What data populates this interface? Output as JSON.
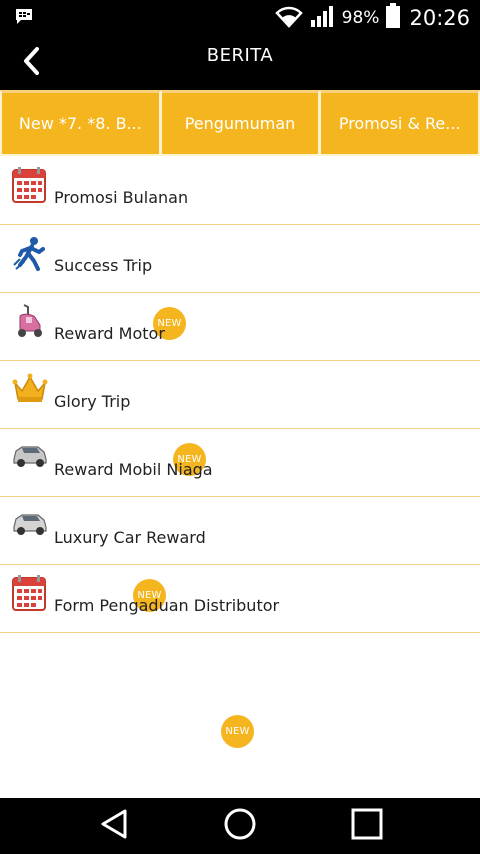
{
  "status_bar": {
    "battery_percent": "98%",
    "time": "20:26",
    "icons": [
      "bbm-icon",
      "wifi-icon",
      "signal-icon",
      "battery-icon"
    ]
  },
  "app_bar": {
    "title": "BERITA",
    "back_icon": "chevron-left-icon"
  },
  "tabs": [
    {
      "label": "New *7. *8. B..."
    },
    {
      "label": "Pengumuman"
    },
    {
      "label": "Promosi & Re..."
    }
  ],
  "items": [
    {
      "label": "Promosi Bulanan",
      "icon": "calendar-icon",
      "badge": ""
    },
    {
      "label": "Success Trip",
      "icon": "running-man-icon",
      "badge": "NEW"
    },
    {
      "label": "Reward Motor",
      "icon": "scooter-icon",
      "badge": "NEW"
    },
    {
      "label": "Glory Trip",
      "icon": "crown-icon",
      "badge": "NEW"
    },
    {
      "label": "Reward Mobil Niaga",
      "icon": "car-icon",
      "badge": "NEW"
    },
    {
      "label": "Luxury Car Reward",
      "icon": "car-icon",
      "badge": ""
    },
    {
      "label": "Form Pengaduan Distributor",
      "icon": "calendar-icon",
      "badge": ""
    }
  ],
  "colors": {
    "accent": "#f4b51f",
    "bar": "#000000",
    "divider": "#f1d48a"
  },
  "nav_bar": {
    "icons": [
      "back-triangle-icon",
      "home-circle-icon",
      "recents-square-icon"
    ]
  }
}
